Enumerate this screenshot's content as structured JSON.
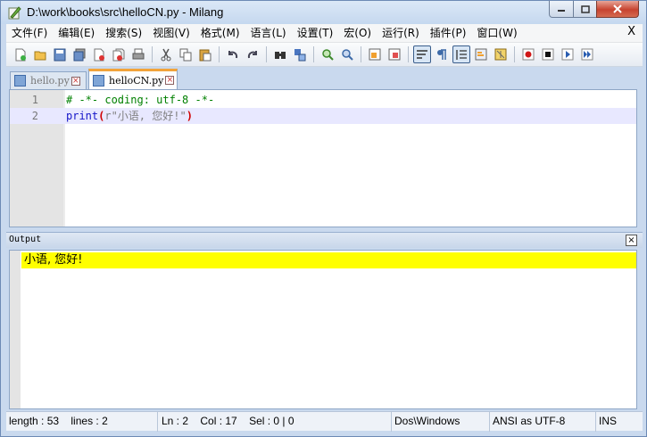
{
  "window": {
    "title": "D:\\work\\books\\src\\helloCN.py - Milang"
  },
  "menubar": {
    "items": [
      {
        "label": "文件(F)"
      },
      {
        "label": "编辑(E)"
      },
      {
        "label": "搜索(S)"
      },
      {
        "label": "视图(V)"
      },
      {
        "label": "格式(M)"
      },
      {
        "label": "语言(L)"
      },
      {
        "label": "设置(T)"
      },
      {
        "label": "宏(O)"
      },
      {
        "label": "运行(R)"
      },
      {
        "label": "插件(P)"
      },
      {
        "label": "窗口(W)"
      }
    ],
    "close_label": "X"
  },
  "toolbar": {
    "icons": [
      "new-file-icon",
      "open-file-icon",
      "save-icon",
      "save-all-icon",
      "close-icon",
      "close-all-icon",
      "print-icon",
      "cut-icon",
      "copy-icon",
      "paste-icon",
      "undo-icon",
      "redo-icon",
      "find-icon",
      "replace-icon",
      "zoom-in-icon",
      "zoom-out-icon",
      "sync-vertical-icon",
      "sync-horizontal-icon",
      "word-wrap-icon",
      "show-all-chars-icon",
      "indent-guide-icon",
      "folder-as-workspace-icon",
      "document-map-icon",
      "record-macro-icon",
      "stop-macro-icon",
      "play-macro-icon",
      "run-macro-multiple-icon"
    ]
  },
  "tabs": [
    {
      "label": "hello.py",
      "active": false
    },
    {
      "label": "helloCN.py",
      "active": true
    }
  ],
  "editor": {
    "lines": [
      {
        "num": "1",
        "comment": "# -*- coding: utf-8 -*-"
      },
      {
        "num": "2",
        "kw": "print",
        "open": "(",
        "str": "r\"小语, 您好!\"",
        "close": ")"
      }
    ]
  },
  "output": {
    "title": "Output",
    "close_label": "×",
    "lines": [
      "小语, 您好!"
    ]
  },
  "status": {
    "length": "length : 53",
    "lines": "lines : 2",
    "ln": "Ln : 2",
    "col": "Col : 17",
    "sel": "Sel : 0 | 0",
    "eol": "Dos\\Windows",
    "encoding": "ANSI as UTF-8",
    "mode": "INS"
  },
  "colors": {
    "title_bar": "#c5d8ef",
    "output_highlight": "#ffff00",
    "current_line": "#e8e8ff",
    "keyword": "#1515c8",
    "comment": "#008000",
    "active_tab_accent": "#f2a33a"
  }
}
